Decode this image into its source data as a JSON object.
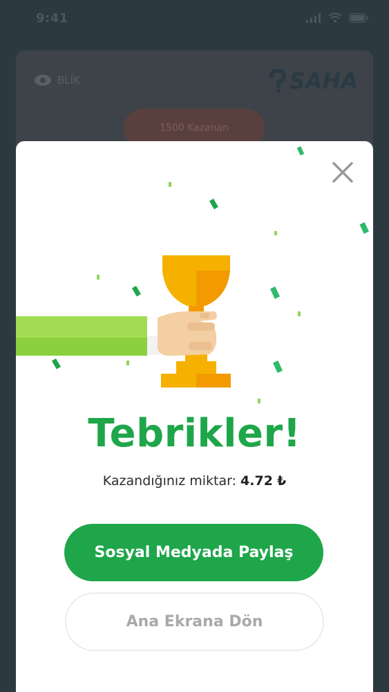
{
  "status_bar": {
    "time": "9:41"
  },
  "background_app": {
    "left_label": "BLİK",
    "logo_text": "SAHA",
    "pill_label": "1500 Kazanan"
  },
  "modal": {
    "title": "Tebrikler!",
    "amount_label": "Kazandığınız miktar: ",
    "amount_value": "4.72",
    "currency": "₺",
    "primary_button": "Sosyal Medyada Paylaş",
    "secondary_button": "Ana Ekrana Dön"
  },
  "colors": {
    "accent_green": "#1fa64a",
    "trophy_gold": "#f6b100",
    "sleeve_green": "#8ccf3f"
  },
  "icons": [
    "close-icon",
    "trophy-icon",
    "wifi-icon",
    "signal-icon",
    "battery-icon",
    "eye-icon"
  ]
}
